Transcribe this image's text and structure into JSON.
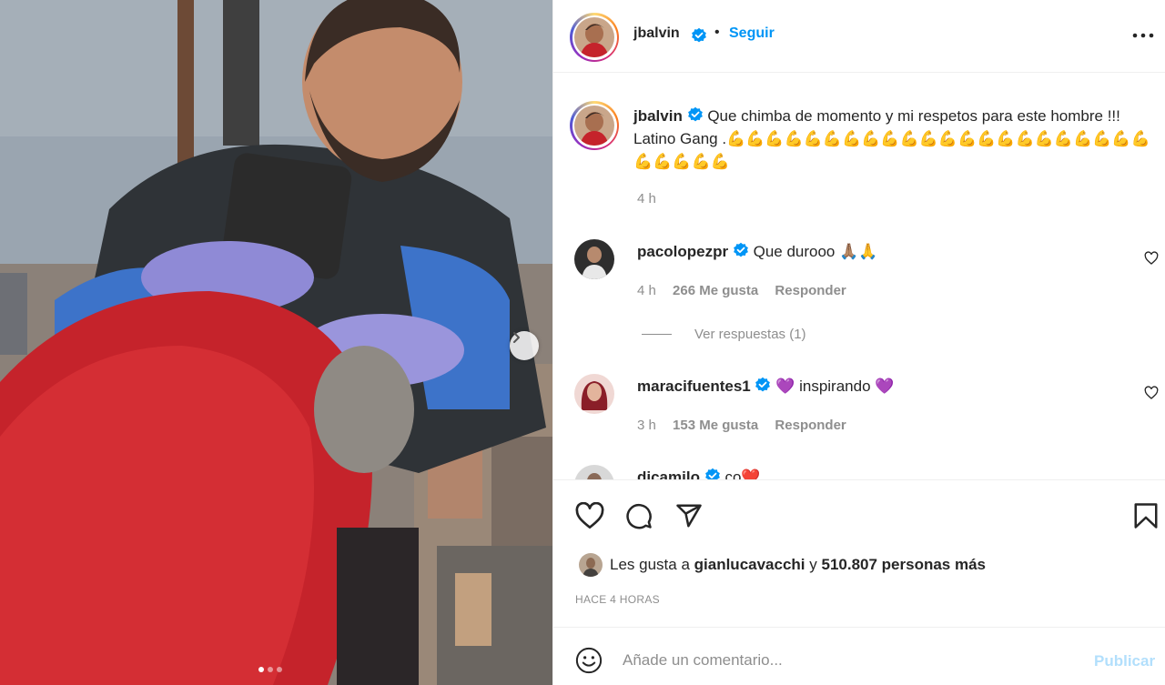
{
  "post": {
    "carousel": {
      "slide_count": 3,
      "active_index": 0
    }
  },
  "header": {
    "username": "jbalvin",
    "separator": "•",
    "follow_label": "Seguir"
  },
  "caption": {
    "username": "jbalvin",
    "text": "Que chimba de momento y mi respetos para este hombre !!! Latino Gang .",
    "emojis": "💪💪💪💪💪💪💪💪💪💪💪💪💪💪💪💪💪💪💪💪💪💪💪💪💪💪💪",
    "time": "4 h"
  },
  "comments": [
    {
      "username": "pacolopezpr",
      "text": "Que durooo 🙏🏽🙏",
      "time": "4 h",
      "likes": "266 Me gusta",
      "reply_label": "Responder"
    },
    {
      "username": "maracifuentes1",
      "text": "💜 inspirando 💜",
      "time": "3 h",
      "likes": "153 Me gusta",
      "reply_label": "Responder"
    },
    {
      "username": "djcamilo",
      "text": "co❤️"
    }
  ],
  "view_replies": "Ver respuestas (1)",
  "likes_line": {
    "prefix": "Les gusta a",
    "user": "gianlucavacchi",
    "connector": "y",
    "count": "510.807 personas más"
  },
  "time_ago": "HACE 4 HORAS",
  "add_comment": {
    "placeholder": "Añade un comentario...",
    "publish_label": "Publicar"
  },
  "colors": {
    "link": "#0095f6",
    "muted": "#8e8e8e",
    "publish_disabled": "#b2dffc",
    "verified": "#0095f6"
  },
  "icons": [
    "verified-badge-icon",
    "more-options-icon",
    "heart-icon",
    "comment-icon",
    "share-icon",
    "save-bookmark-icon",
    "emoji-icon",
    "chevron-right-icon"
  ]
}
